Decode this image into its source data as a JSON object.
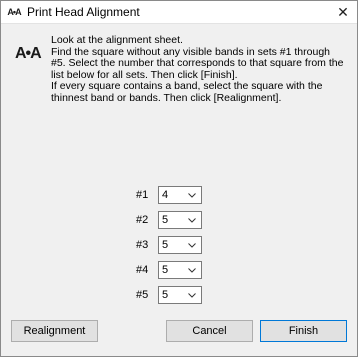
{
  "window": {
    "title": "Print Head Alignment",
    "app_icon_text": "A•A",
    "close_glyph": "✕"
  },
  "big_icon_text": "A•A",
  "instructions": {
    "line1": "Look at the alignment sheet.",
    "line2": "Find the square without any visible bands in sets #1 through #5. Select the number that corresponds to that square from the list below for all sets. Then click [Finish].",
    "line3": "If every square contains a band, select the square with the thinnest band or bands. Then click [Realignment]."
  },
  "sets": [
    {
      "label": "#1",
      "value": "4"
    },
    {
      "label": "#2",
      "value": "5"
    },
    {
      "label": "#3",
      "value": "5"
    },
    {
      "label": "#4",
      "value": "5"
    },
    {
      "label": "#5",
      "value": "5"
    }
  ],
  "buttons": {
    "realignment": "Realignment",
    "cancel": "Cancel",
    "finish": "Finish"
  },
  "colors": {
    "default_button_border": "#0078d7"
  }
}
